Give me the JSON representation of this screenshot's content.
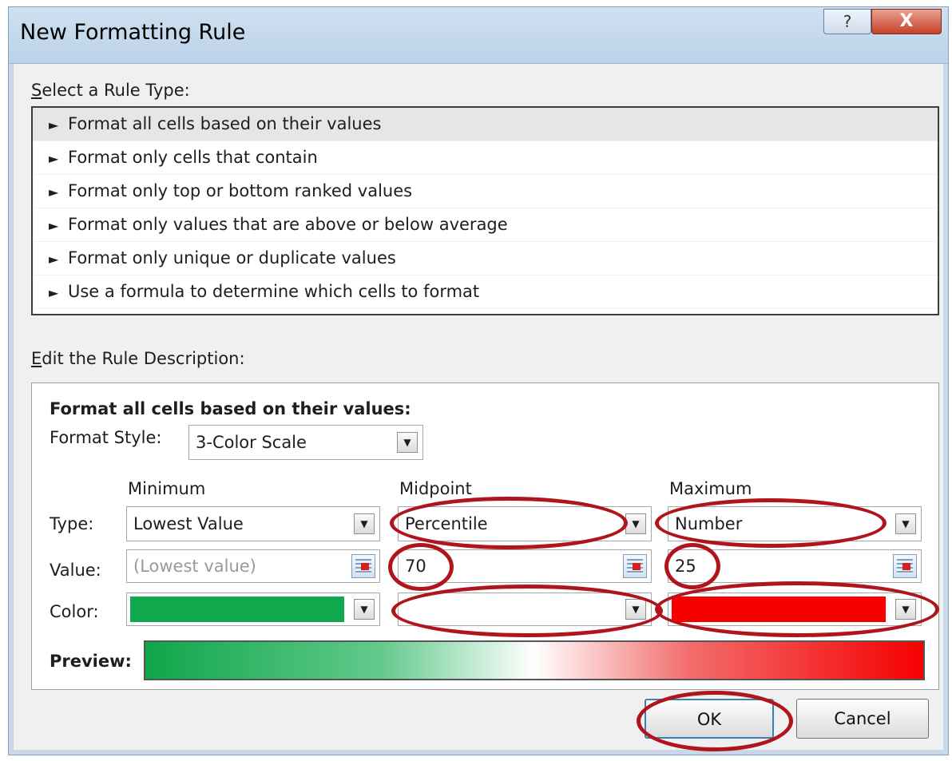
{
  "window": {
    "title": "New Formatting Rule",
    "help_glyph": "?",
    "close_glyph": "X"
  },
  "rule_type": {
    "label": "Select a Rule Type:",
    "arrow_glyph": "►",
    "items": [
      "Format all cells based on their values",
      "Format only cells that contain",
      "Format only top or bottom ranked values",
      "Format only values that are above or below average",
      "Format only unique or duplicate values",
      "Use a formula to determine which cells to format"
    ],
    "selected_index": 0
  },
  "rule_description": {
    "label": "Edit the Rule Description:",
    "heading": "Format all cells based on their values:",
    "format_style_label": "Format Style:",
    "format_style_value": "3-Color Scale",
    "column_headers": {
      "minimum": "Minimum",
      "midpoint": "Midpoint",
      "maximum": "Maximum"
    },
    "row_labels": {
      "type": "Type:",
      "value": "Value:",
      "color": "Color:"
    },
    "minimum": {
      "type": "Lowest Value",
      "value_placeholder": "(Lowest value)",
      "color": "#10a84c"
    },
    "midpoint": {
      "type": "Percentile",
      "value": "70",
      "color": "#ffffff"
    },
    "maximum": {
      "type": "Number",
      "value": "25",
      "color": "#f80000"
    },
    "preview_label": "Preview:"
  },
  "buttons": {
    "ok": "OK",
    "cancel": "Cancel"
  },
  "icons": {
    "dropdown": "▼",
    "ref_picker": "range-selector-icon"
  },
  "colors": {
    "annotation": "#b0151d",
    "title_bar": "#c4d7ec",
    "close": "#c6412a"
  }
}
